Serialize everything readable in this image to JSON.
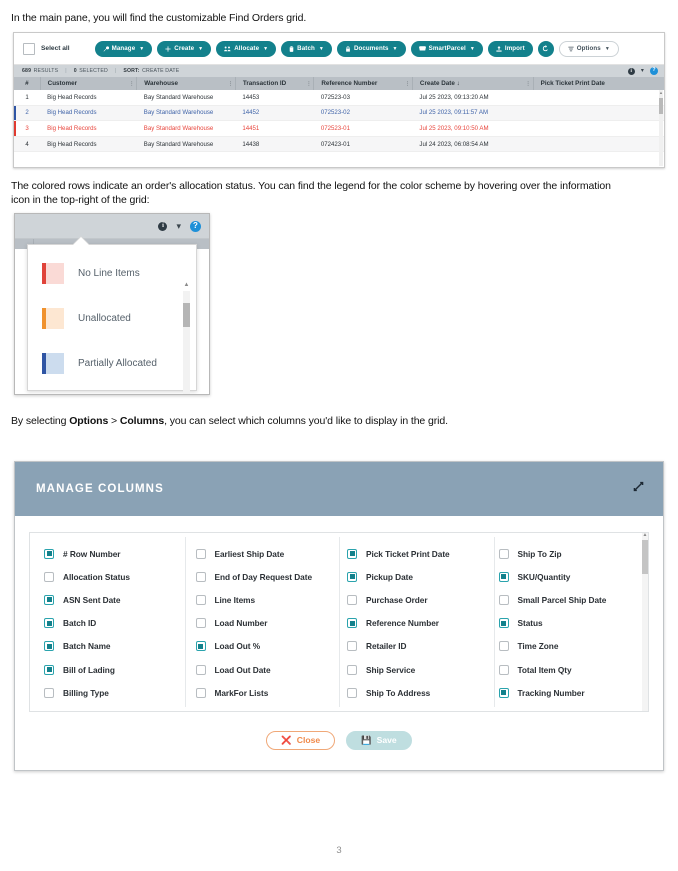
{
  "intro_text": "In the main pane, you will find the customizable Find Orders grid.",
  "legend_text": "The colored rows indicate an order's allocation status. You can find the legend for the color scheme by hovering over the information icon in the top-right of the grid:",
  "options_text_prefix": "By selecting ",
  "options_text_bold1": "Options",
  "options_text_mid": " > ",
  "options_text_bold2": "Columns",
  "options_text_suffix": ", you can select which columns you'd like to display in the grid.",
  "page_number": "3",
  "colors": {
    "teal": "#13818c",
    "dialog_header": "#8aa2b5",
    "header_row": "#b9bfc5",
    "infobar": "#cfd4d8",
    "row_blue_text": "#3f63a8",
    "row_red_text": "#e8453c",
    "bar_blue": "#2f55a4",
    "bar_red": "#e03a30",
    "close_orange": "#f08a4b",
    "save_disabled": "#bfdee0"
  },
  "grid": {
    "select_all_label": "Select all",
    "toolbar_buttons": [
      {
        "label": "Manage",
        "icon": "wrench-icon",
        "caret": true,
        "style": "teal"
      },
      {
        "label": "Create",
        "icon": "plus-icon",
        "caret": true,
        "style": "teal"
      },
      {
        "label": "Allocate",
        "icon": "allocate-icon",
        "caret": true,
        "style": "teal"
      },
      {
        "label": "Batch",
        "icon": "batch-icon",
        "caret": true,
        "style": "teal"
      },
      {
        "label": "Documents",
        "icon": "lock-icon",
        "caret": true,
        "style": "teal"
      },
      {
        "label": "SmartParcel",
        "icon": "parcel-icon",
        "caret": true,
        "style": "teal"
      },
      {
        "label": "Import",
        "icon": "upload-icon",
        "caret": false,
        "style": "teal"
      },
      {
        "label": "",
        "icon": "refresh-icon",
        "caret": false,
        "style": "teal-round"
      },
      {
        "label": "Options",
        "icon": "list-icon",
        "caret": true,
        "style": "ghost"
      }
    ],
    "infobar": {
      "results_count": "689",
      "results_label": "RESULTS",
      "selected_count": "0",
      "selected_label": "SELECTED",
      "sort_label": "SORT:",
      "sort_value": "CREATE DATE",
      "info_icon": "info-icon",
      "chevron_icon": "chevron-down-icon",
      "help_icon": "help-icon"
    },
    "columns": [
      "#",
      "Customer",
      "Warehouse",
      "Transaction ID",
      "Reference Number",
      "Create Date ↓",
      "Pick Ticket Print Date"
    ],
    "rows": [
      {
        "num": "1",
        "customer": "Big Head Records",
        "warehouse": "Bay Standard Warehouse",
        "transaction_id": "14453",
        "reference_number": "072523-03",
        "create_date": "Jul 25 2023, 09:13:20 AM",
        "pick_ticket": "",
        "status": "none"
      },
      {
        "num": "2",
        "customer": "Big Head Records",
        "warehouse": "Bay Standard Warehouse",
        "transaction_id": "14452",
        "reference_number": "072523-02",
        "create_date": "Jul 25 2023, 09:11:57 AM",
        "pick_ticket": "",
        "status": "partially-allocated"
      },
      {
        "num": "3",
        "customer": "Big Head Records",
        "warehouse": "Bay Standard Warehouse",
        "transaction_id": "14451",
        "reference_number": "072523-01",
        "create_date": "Jul 25 2023, 09:10:50 AM",
        "pick_ticket": "",
        "status": "no-line-items"
      },
      {
        "num": "4",
        "customer": "Big Head Records",
        "warehouse": "Bay Standard Warehouse",
        "transaction_id": "14438",
        "reference_number": "072423-01",
        "create_date": "Jul 24 2023, 06:08:54 AM",
        "pick_ticket": "",
        "status": "none"
      }
    ]
  },
  "legend": {
    "items": [
      {
        "label": "No Line Items",
        "bar": "#e0433a",
        "fill": "#fadad6"
      },
      {
        "label": "Unallocated",
        "bar": "#f0922e",
        "fill": "#fde7d2"
      },
      {
        "label": "Partially Allocated",
        "bar": "#2f55a4",
        "fill": "#ccdcee"
      }
    ]
  },
  "manage_columns": {
    "title": "MANAGE COLUMNS",
    "expand_icon": "expand-icon",
    "close_label": "Close",
    "close_icon": "close-circle-icon",
    "save_label": "Save",
    "save_icon": "save-icon",
    "columns": [
      [
        {
          "label": "# Row Number",
          "checked": true
        },
        {
          "label": "Allocation Status",
          "checked": false
        },
        {
          "label": "ASN Sent Date",
          "checked": true
        },
        {
          "label": "Batch ID",
          "checked": true
        },
        {
          "label": "Batch Name",
          "checked": true
        },
        {
          "label": "Bill of Lading",
          "checked": true
        },
        {
          "label": "Billing Type",
          "checked": false
        }
      ],
      [
        {
          "label": "Earliest Ship Date",
          "checked": false
        },
        {
          "label": "End of Day Request Date",
          "checked": false
        },
        {
          "label": "Line Items",
          "checked": false
        },
        {
          "label": "Load Number",
          "checked": false
        },
        {
          "label": "Load Out %",
          "checked": true
        },
        {
          "label": "Load Out Date",
          "checked": false
        },
        {
          "label": "MarkFor Lists",
          "checked": false
        }
      ],
      [
        {
          "label": "Pick Ticket Print Date",
          "checked": true
        },
        {
          "label": "Pickup Date",
          "checked": true
        },
        {
          "label": "Purchase Order",
          "checked": false
        },
        {
          "label": "Reference Number",
          "checked": true
        },
        {
          "label": "Retailer ID",
          "checked": false
        },
        {
          "label": "Ship Service",
          "checked": false
        },
        {
          "label": "Ship To Address",
          "checked": false
        }
      ],
      [
        {
          "label": "Ship To Zip",
          "checked": false
        },
        {
          "label": "SKU/Quantity",
          "checked": true
        },
        {
          "label": "Small Parcel Ship Date",
          "checked": false
        },
        {
          "label": "Status",
          "checked": true
        },
        {
          "label": "Time Zone",
          "checked": false
        },
        {
          "label": "Total Item Qty",
          "checked": false
        },
        {
          "label": "Tracking Number",
          "checked": true
        }
      ]
    ]
  }
}
